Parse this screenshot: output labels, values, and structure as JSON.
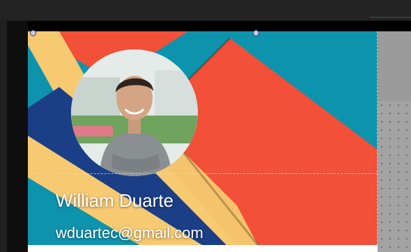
{
  "card": {
    "name": "William Duarte",
    "email": "wduartec@gmail.com"
  },
  "colors": {
    "teal": "#0e93ad",
    "red": "#f25038",
    "yellow": "#f7c971",
    "navy": "#1b3f86",
    "canvas": "#000000",
    "panel": "#9b9b9b"
  },
  "icons": {
    "photo": "profile-photo",
    "handles": "selection-handle"
  }
}
